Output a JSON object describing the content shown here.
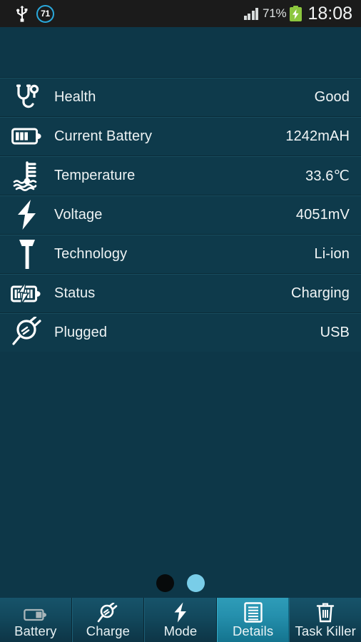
{
  "status_bar": {
    "usb_icon": "usb-icon",
    "battery_circle_value": "71",
    "signal_icon": "signal-bars-icon",
    "battery_percent": "71%",
    "battery_charging_icon": "battery-charging-icon",
    "time": "18:08"
  },
  "colors": {
    "background": "#0d3748",
    "row_background": "#0e3a4b",
    "status_bar": "#1b1b1b",
    "accent": "#2aa8db",
    "active_tab": "#2590ad",
    "battery_green": "#8cc63e",
    "dot_active": "#79cde8",
    "dot_inactive": "#070a0b"
  },
  "details": {
    "rows": [
      {
        "icon": "stethoscope-icon",
        "label": "Health",
        "value": "Good"
      },
      {
        "icon": "battery-icon",
        "label": "Current Battery",
        "value": "1242mAH"
      },
      {
        "icon": "thermometer-icon",
        "label": "Temperature",
        "value": "33.6℃"
      },
      {
        "icon": "lightning-bolt-icon",
        "label": "Voltage",
        "value": "4051mV"
      },
      {
        "icon": "hammer-icon",
        "label": "Technology",
        "value": "Li-ion"
      },
      {
        "icon": "battery-charging-icon",
        "label": "Status",
        "value": "Charging"
      },
      {
        "icon": "power-plug-icon",
        "label": "Plugged",
        "value": "USB"
      }
    ]
  },
  "pager": {
    "dots": [
      {
        "name": "page-dot-1",
        "active": false
      },
      {
        "name": "page-dot-2",
        "active": true
      }
    ]
  },
  "tabbar": {
    "tabs": [
      {
        "icon": "battery-icon",
        "label": "Battery",
        "active": false
      },
      {
        "icon": "power-plug-icon",
        "label": "Charge",
        "active": false
      },
      {
        "icon": "lightning-bolt-icon",
        "label": "Mode",
        "active": false
      },
      {
        "icon": "document-lines-icon",
        "label": "Details",
        "active": true
      },
      {
        "icon": "trash-can-icon",
        "label": "Task Killer",
        "active": false
      }
    ]
  }
}
